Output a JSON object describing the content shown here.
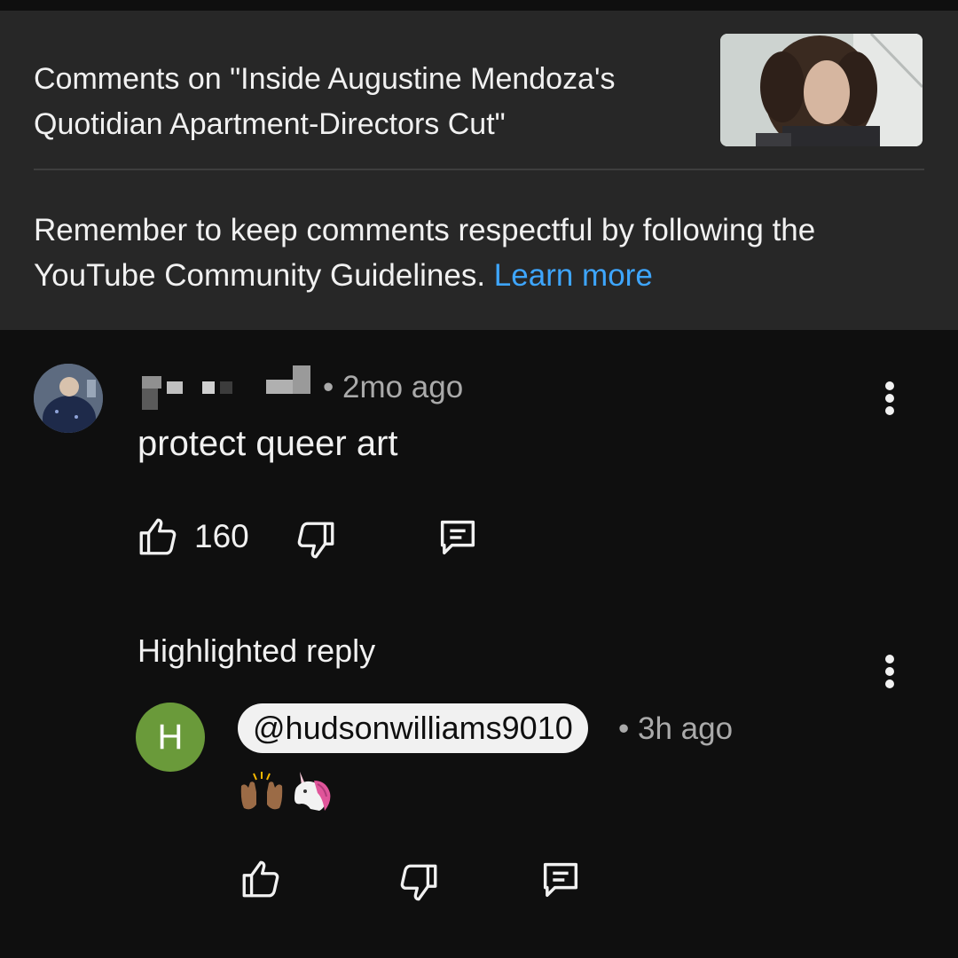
{
  "header": {
    "title": "Comments on \"Inside Augustine Mendoza's Quotidian Apartment-Directors Cut\"",
    "guideline_text": "Remember to keep comments respectful by following the YouTube Community Guidelines. ",
    "learn_more": "Learn more"
  },
  "comment": {
    "author": "",
    "meta": "• 2mo ago",
    "text": "protect queer art",
    "likes": "160"
  },
  "highlighted": {
    "label": "Highlighted reply",
    "avatar_letter": "H",
    "handle": "@hudsonwilliams9010",
    "meta": "• 3h ago",
    "emojis": [
      "raising-hands-medium-dark-skin",
      "unicorn"
    ]
  },
  "colors": {
    "header_bg": "#272727",
    "page_bg": "#0f0f0f",
    "link": "#3ea6ff",
    "avatar_h": "#6a9a3a"
  }
}
